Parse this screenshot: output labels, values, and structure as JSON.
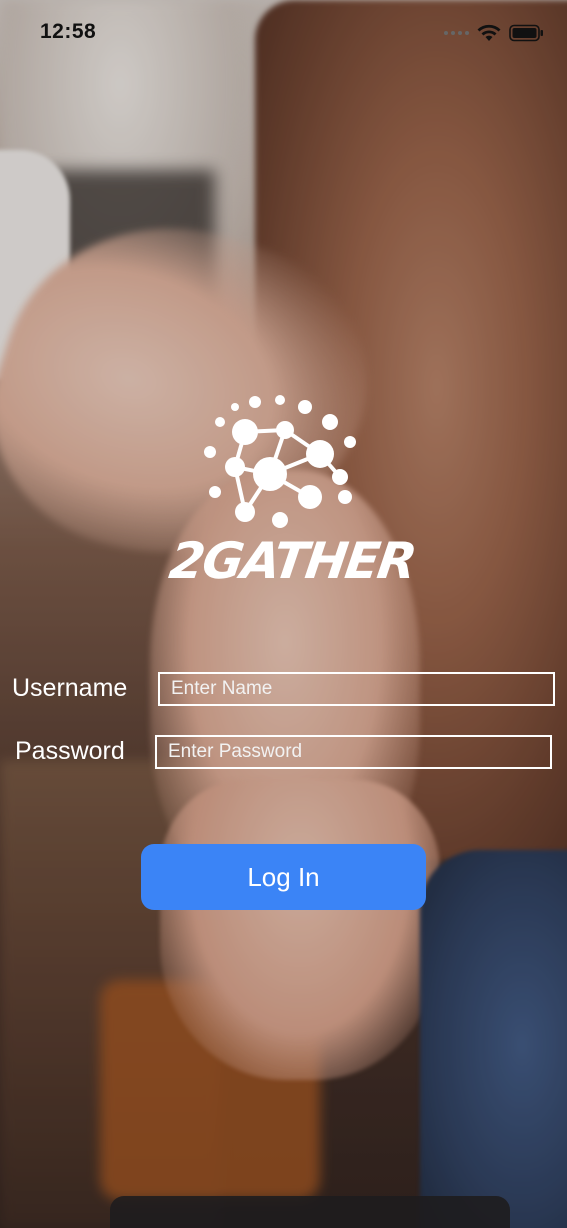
{
  "status_bar": {
    "time": "12:58",
    "icons": [
      "cellular-signal-icon",
      "wifi-icon",
      "battery-icon"
    ]
  },
  "logo": {
    "text": "2GATHER",
    "icon": "network-molecule-icon"
  },
  "form": {
    "username_label": "Username",
    "username_placeholder": "Enter Name",
    "username_value": "",
    "password_label": "Password",
    "password_placeholder": "Enter Password",
    "password_value": ""
  },
  "actions": {
    "login_label": "Log In"
  },
  "colors": {
    "accent": "#3b84f6",
    "text_on_bg": "#ffffff",
    "status_text": "#111111"
  }
}
